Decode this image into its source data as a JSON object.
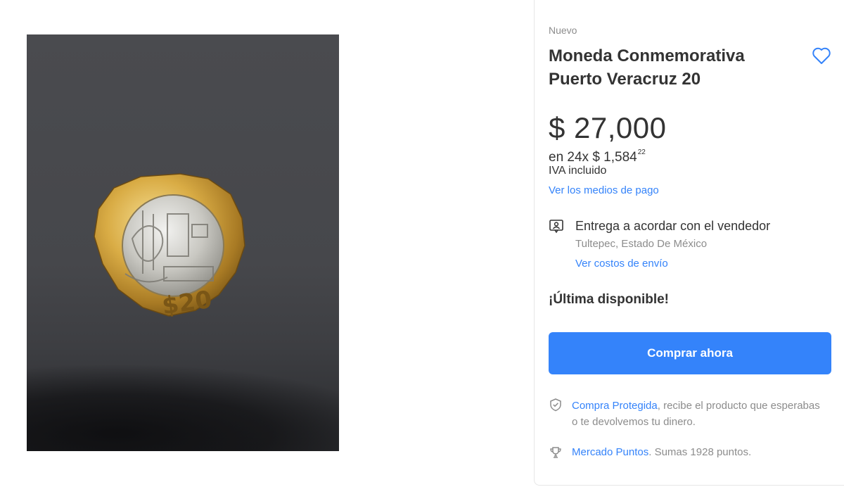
{
  "product": {
    "condition": "Nuevo",
    "title": "Moneda Conmemorativa Puerto Veracruz 20",
    "price": "$ 27,000",
    "installments": {
      "prefix": "en 24x $ 1,584",
      "cents": "22"
    },
    "tax_note": "IVA incluido",
    "payment_link": "Ver los medios de pago"
  },
  "shipping": {
    "title": "Entrega a acordar con el vendedor",
    "location": "Tultepec, Estado De México",
    "cost_link": "Ver costos de envío"
  },
  "stock": "¡Última disponible!",
  "buy_button": "Comprar ahora",
  "protection": {
    "link": "Compra Protegida",
    "text": ", recibe el producto que esperabas o te devolvemos tu dinero."
  },
  "points": {
    "link": "Mercado Puntos",
    "text": ". Sumas 1928 puntos."
  },
  "icons": {
    "favorite": "heart-outline-icon",
    "shipping": "person-card-icon",
    "protection": "shield-check-icon",
    "points": "trophy-icon"
  },
  "colors": {
    "accent": "#3483fa",
    "text": "#333333",
    "muted": "#8c8c8c"
  }
}
